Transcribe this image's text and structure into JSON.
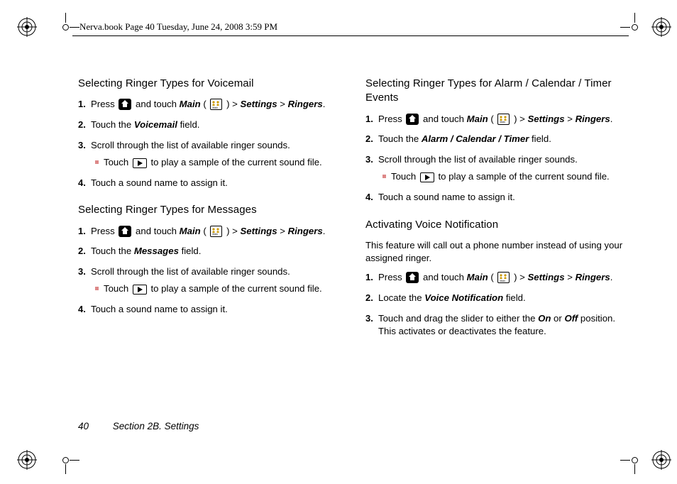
{
  "header": "Nerva.book  Page 40  Tuesday, June 24, 2008  3:59 PM",
  "left": {
    "s1": {
      "title": "Selecting Ringer Types for Voicemail",
      "i1a": "Press ",
      "i1b": " and touch ",
      "i1_main": "Main",
      "i1c": " ( ",
      "i1d": " ) > ",
      "i1_set": "Settings",
      "i1e": " > ",
      "i1_ring": "Ringers",
      "i1f": ".",
      "i2a": "Touch the ",
      "i2_field": "Voicemail",
      "i2b": " field.",
      "i3": "Scroll through the list of available ringer sounds.",
      "i3s": "Touch ",
      "i3s2": " to play a sample of the current sound file.",
      "i4": "Touch a sound name to assign it."
    },
    "s2": {
      "title": "Selecting Ringer Types for Messages",
      "i1a": "Press ",
      "i1b": " and touch ",
      "i1_main": "Main",
      "i1c": " ( ",
      "i1d": " ) > ",
      "i1_set": "Settings",
      "i1e": " > ",
      "i1_ring": "Ringers",
      "i1f": ".",
      "i2a": "Touch the ",
      "i2_field": "Messages",
      "i2b": " field.",
      "i3": "Scroll through the list of available ringer sounds.",
      "i3s": "Touch ",
      "i3s2": " to play a sample of the current sound file.",
      "i4": "Touch a sound name to assign it."
    }
  },
  "right": {
    "s1": {
      "title": "Selecting Ringer Types for Alarm / Calendar / Timer Events",
      "i1a": "Press ",
      "i1b": " and touch ",
      "i1_main": "Main",
      "i1c": " ( ",
      "i1d": " ) > ",
      "i1_set": "Settings",
      "i1e": " > ",
      "i1_ring": "Ringers",
      "i1f": ".",
      "i2a": "Touch the ",
      "i2_field": "Alarm / Calendar / Timer",
      "i2b": " field.",
      "i3": "Scroll through the list of available ringer sounds.",
      "i3s": "Touch ",
      "i3s2": " to play a sample of the current sound file.",
      "i4": "Touch a sound name to assign it."
    },
    "s2": {
      "title": "Activating Voice Notification",
      "intro": "This feature will call out a phone number instead of using your assigned ringer.",
      "i1a": "Press ",
      "i1b": " and touch ",
      "i1_main": "Main",
      "i1c": " ( ",
      "i1d": " ) > ",
      "i1_set": "Settings",
      "i1e": " > ",
      "i1_ring": "Ringers",
      "i1f": ".",
      "i2a": "Locate the ",
      "i2_field": "Voice Notification",
      "i2b": " field.",
      "i3a": "Touch and drag the slider to either the ",
      "i3_on": "On",
      "i3b": " or ",
      "i3_off": "Off",
      "i3c": " position. This activates or deactivates the feature."
    }
  },
  "footer": {
    "page": "40",
    "section": "Section 2B. Settings"
  }
}
